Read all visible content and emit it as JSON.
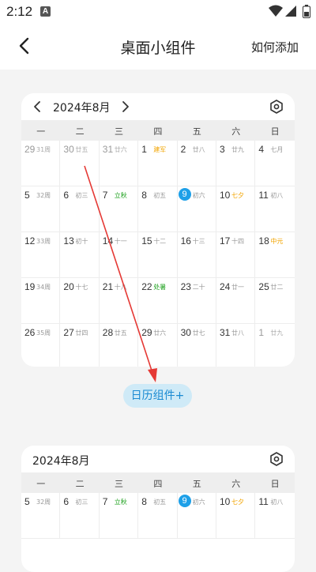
{
  "status": {
    "time": "2:12",
    "notif": "A"
  },
  "header": {
    "title": "桌面小组件",
    "action": "如何添加"
  },
  "weekdays": [
    "一",
    "二",
    "三",
    "四",
    "五",
    "六",
    "日"
  ],
  "widget1": {
    "month_label": "2024年8月",
    "weeks": [
      [
        {
          "d": "29",
          "s": "31周",
          "t": "gray",
          "dg": true
        },
        {
          "d": "30",
          "s": "廿五",
          "t": "gray",
          "dg": true
        },
        {
          "d": "31",
          "s": "廿六",
          "t": "gray",
          "dg": true
        },
        {
          "d": "1",
          "s": "建军",
          "t": "orange"
        },
        {
          "d": "2",
          "s": "廿八",
          "t": ""
        },
        {
          "d": "3",
          "s": "廿九",
          "t": ""
        },
        {
          "d": "4",
          "s": "七月",
          "t": ""
        }
      ],
      [
        {
          "d": "5",
          "s": "32周",
          "t": ""
        },
        {
          "d": "6",
          "s": "初三",
          "t": ""
        },
        {
          "d": "7",
          "s": "立秋",
          "t": "green"
        },
        {
          "d": "8",
          "s": "初五",
          "t": ""
        },
        {
          "d": "9",
          "s": "初六",
          "t": "",
          "today": true
        },
        {
          "d": "10",
          "s": "七夕",
          "t": "orange"
        },
        {
          "d": "11",
          "s": "初八",
          "t": ""
        }
      ],
      [
        {
          "d": "12",
          "s": "33周",
          "t": ""
        },
        {
          "d": "13",
          "s": "初十",
          "t": ""
        },
        {
          "d": "14",
          "s": "十一",
          "t": ""
        },
        {
          "d": "15",
          "s": "十二",
          "t": ""
        },
        {
          "d": "16",
          "s": "十三",
          "t": ""
        },
        {
          "d": "17",
          "s": "十四",
          "t": ""
        },
        {
          "d": "18",
          "s": "中元",
          "t": "orange"
        }
      ],
      [
        {
          "d": "19",
          "s": "34周",
          "t": ""
        },
        {
          "d": "20",
          "s": "十七",
          "t": ""
        },
        {
          "d": "21",
          "s": "十八",
          "t": ""
        },
        {
          "d": "22",
          "s": "处暑",
          "t": "green"
        },
        {
          "d": "23",
          "s": "二十",
          "t": ""
        },
        {
          "d": "24",
          "s": "廿一",
          "t": ""
        },
        {
          "d": "25",
          "s": "廿二",
          "t": ""
        }
      ],
      [
        {
          "d": "26",
          "s": "35周",
          "t": ""
        },
        {
          "d": "27",
          "s": "廿四",
          "t": ""
        },
        {
          "d": "28",
          "s": "廿五",
          "t": ""
        },
        {
          "d": "29",
          "s": "廿六",
          "t": ""
        },
        {
          "d": "30",
          "s": "廿七",
          "t": ""
        },
        {
          "d": "31",
          "s": "廿八",
          "t": ""
        },
        {
          "d": "1",
          "s": "廿九",
          "t": "gray",
          "dg": true
        }
      ]
    ]
  },
  "add_button": "日历组件+",
  "widget2": {
    "month_label": "2024年8月",
    "weeks": [
      [
        {
          "d": "5",
          "s": "32周",
          "t": ""
        },
        {
          "d": "6",
          "s": "初三",
          "t": ""
        },
        {
          "d": "7",
          "s": "立秋",
          "t": "green"
        },
        {
          "d": "8",
          "s": "初五",
          "t": ""
        },
        {
          "d": "9",
          "s": "初六",
          "t": "",
          "today": true
        },
        {
          "d": "10",
          "s": "七夕",
          "t": "orange"
        },
        {
          "d": "11",
          "s": "初八",
          "t": ""
        }
      ]
    ]
  },
  "colors": {
    "accent": "#1ea0e8",
    "festival": "#f2a400",
    "solar_term": "#1ea01e",
    "arrow": "#e53935",
    "button_bg": "#cfeaf7"
  }
}
